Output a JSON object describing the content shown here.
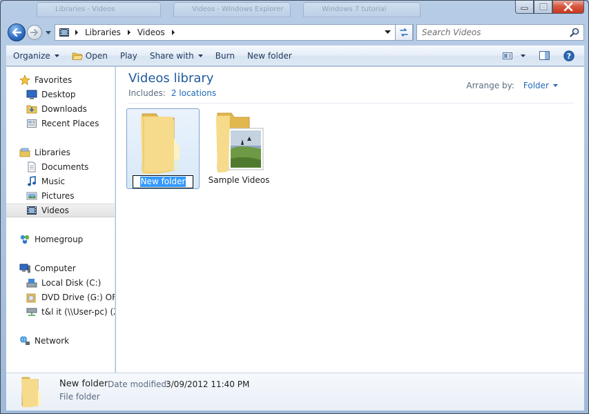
{
  "window": {
    "background_tabs": [
      "Libraries - Videos",
      "Videos - Windows Explorer",
      "Windows 7 tutorial"
    ]
  },
  "navigation": {
    "breadcrumbs": [
      "Libraries",
      "Videos"
    ],
    "search_placeholder": "Search Videos"
  },
  "toolbar": {
    "organize": "Organize",
    "open": "Open",
    "play": "Play",
    "share_with": "Share with",
    "burn": "Burn",
    "new_folder": "New folder"
  },
  "nav_pane": {
    "favorites": "Favorites",
    "favorites_items": [
      "Desktop",
      "Downloads",
      "Recent Places"
    ],
    "libraries": "Libraries",
    "libraries_items": [
      "Documents",
      "Music",
      "Pictures",
      "Videos"
    ],
    "selected": "Videos",
    "homegroup": "Homegroup",
    "computer": "Computer",
    "computer_items": [
      "Local Disk (C:)",
      "DVD Drive (G:) OFFIC",
      "t&l it (\\\\User-pc) (Z:"
    ],
    "network": "Network"
  },
  "library": {
    "title": "Videos library",
    "includes_label": "Includes:",
    "includes_link": "2 locations",
    "arrange_label": "Arrange by:",
    "arrange_value": "Folder"
  },
  "items": [
    {
      "name": "New folder",
      "state": "renaming"
    },
    {
      "name": "Sample Videos",
      "state": "normal"
    }
  ],
  "details": {
    "name": "New folder",
    "modified_label": "Date modified:",
    "modified_value": "3/09/2012 11:40 PM",
    "type": "File folder"
  },
  "icons": {
    "back": "back-arrow-icon",
    "forward": "forward-arrow-icon",
    "refresh": "refresh-icon",
    "search": "search-icon",
    "help": "help-icon"
  },
  "colors": {
    "accent_text": "#1e5a9e",
    "link": "#1f69b8",
    "selection": "#3399ff"
  }
}
